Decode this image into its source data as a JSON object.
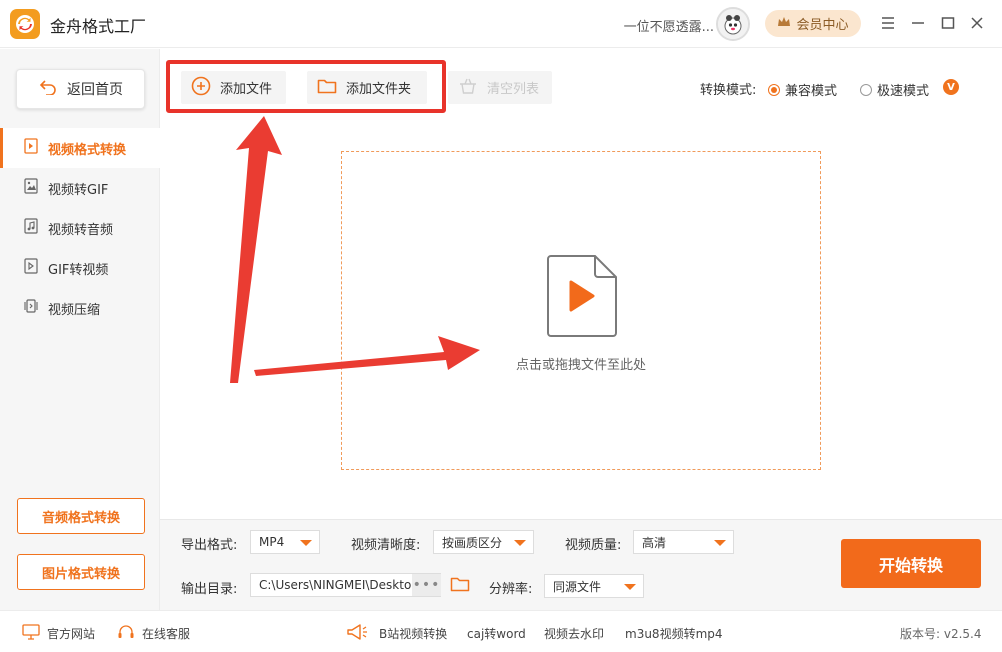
{
  "app": {
    "title": "金舟格式工厂"
  },
  "user": {
    "name": "一位不愿透露...",
    "vip_label": "会员中心"
  },
  "sidebar": {
    "back_label": "返回首页",
    "items": [
      {
        "label": "视频格式转换",
        "icon": "video-file-icon",
        "active": true
      },
      {
        "label": "视频转GIF",
        "icon": "image-icon",
        "active": false
      },
      {
        "label": "视频转音频",
        "icon": "music-file-icon",
        "active": false
      },
      {
        "label": "GIF转视频",
        "icon": "gif-video-icon",
        "active": false
      },
      {
        "label": "视频压缩",
        "icon": "compress-icon",
        "active": false
      }
    ],
    "audio_btn": "音频格式转换",
    "image_btn": "图片格式转换"
  },
  "toolbar": {
    "add_file": "添加文件",
    "add_folder": "添加文件夹",
    "clear_list": "清空列表",
    "mode_label": "转换模式:",
    "mode_options": [
      {
        "label": "兼容模式",
        "checked": true
      },
      {
        "label": "极速模式",
        "checked": false
      }
    ],
    "vip_badge": "V"
  },
  "dropzone": {
    "text": "点击或拖拽文件至此处"
  },
  "settings": {
    "export_format_label": "导出格式:",
    "export_format_value": "MP4",
    "clarity_label": "视频清晰度:",
    "clarity_value": "按画质区分",
    "quality_label": "视频质量:",
    "quality_value": "高清",
    "output_dir_label": "输出目录:",
    "output_dir_value": "C:\\Users\\NINGMEI\\Desktop",
    "resolution_label": "分辨率:",
    "resolution_value": "同源文件",
    "start_label": "开始转换"
  },
  "footer": {
    "website": "官方网站",
    "support": "在线客服",
    "links": [
      "B站视频转换",
      "caj转word",
      "视频去水印",
      "m3u8视频转mp4"
    ],
    "version": "版本号: v2.5.4"
  },
  "colors": {
    "accent": "#f0731e",
    "highlight": "#e8332a",
    "start": "#f26a1b"
  }
}
